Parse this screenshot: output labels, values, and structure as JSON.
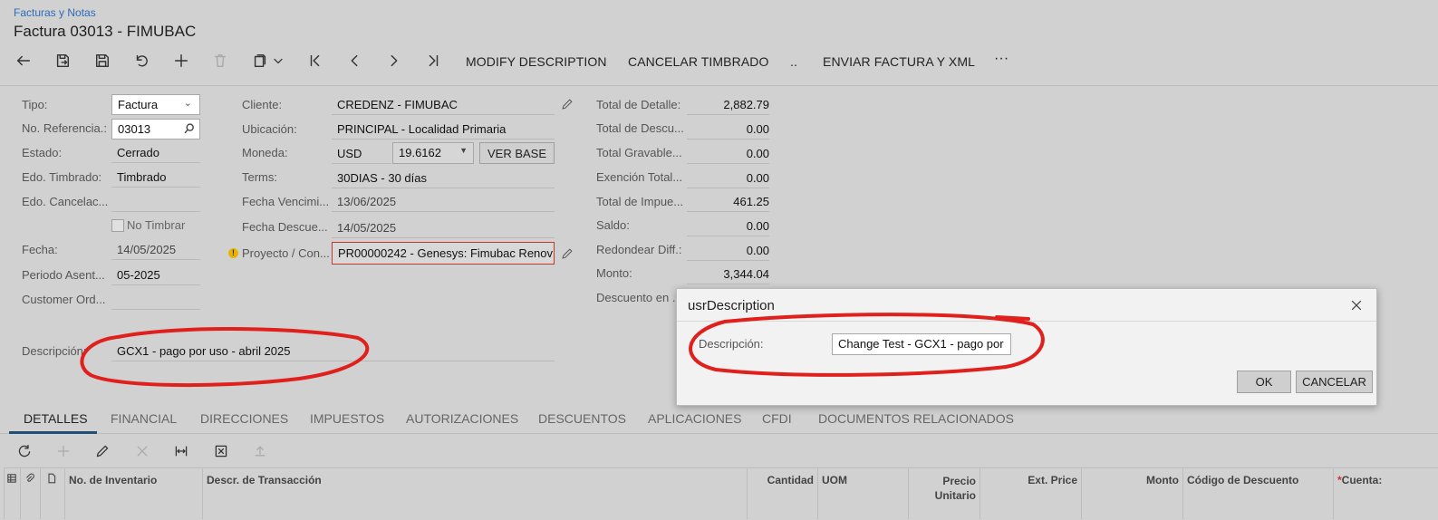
{
  "header": {
    "breadcrumb": "Facturas y Notas",
    "title": "Factura 03013 - FIMUBAC"
  },
  "toolbar": {
    "actions": [
      "MODIFY DESCRIPTION",
      "CANCELAR TIMBRADO",
      "..",
      "ENVIAR FACTURA Y XML",
      "···"
    ]
  },
  "form": {
    "col1": {
      "tipo_label": "Tipo:",
      "tipo_value": "Factura",
      "referencia_label": "No. Referencia.:",
      "referencia_value": "03013",
      "estado_label": "Estado:",
      "estado_value": "Cerrado",
      "timbrado_label": "Edo. Timbrado:",
      "timbrado_value": "Timbrado",
      "cancelacion_label": "Edo. Cancelac...",
      "no_timbrar_label": "No Timbrar",
      "fecha_label": "Fecha:",
      "fecha_value": "14/05/2025",
      "periodo_label": "Periodo Asent...",
      "periodo_value": "05-2025",
      "customer_order_label": "Customer Ord...",
      "descripcion_label": "Descripción:",
      "descripcion_value": "GCX1 - pago por uso - abril 2025"
    },
    "col2": {
      "cliente_label": "Cliente:",
      "cliente_value": "CREDENZ - FIMUBAC",
      "ubicacion_label": "Ubicación:",
      "ubicacion_value": "PRINCIPAL - Localidad Primaria",
      "moneda_label": "Moneda:",
      "moneda_value": "USD",
      "tasa_value": "19.6162",
      "ver_base_label": "VER BASE",
      "terms_label": "Terms:",
      "terms_value": "30DIAS - 30 días",
      "vencimiento_label": "Fecha Vencimi...",
      "vencimiento_value": "13/06/2025",
      "descuento_label": "Fecha Descue...",
      "descuento_value": "14/05/2025",
      "proyecto_label": "Proyecto / Con...",
      "proyecto_value": "PR00000242 - Genesys: Fimubac Renov"
    },
    "totals": {
      "detalle_label": "Total de Detalle:",
      "detalle_value": "2,882.79",
      "descuento_label": "Total de Descu...",
      "descuento_value": "0.00",
      "gravable_label": "Total Gravable...",
      "gravable_value": "0.00",
      "exencion_label": "Exención Total...",
      "exencion_value": "0.00",
      "impuesto_label": "Total de Impue...",
      "impuesto_value": "461.25",
      "saldo_label": "Saldo:",
      "saldo_value": "0.00",
      "redondear_label": "Redondear Diff.:",
      "redondear_value": "0.00",
      "monto_label": "Monto:",
      "monto_value": "3,344.04",
      "descuento_en_label": "Descuento en ..."
    }
  },
  "tabs": [
    "DETALLES",
    "FINANCIAL",
    "DIRECCIONES",
    "IMPUESTOS",
    "AUTORIZACIONES",
    "DESCUENTOS",
    "APLICACIONES",
    "CFDI",
    "DOCUMENTOS RELACIONADOS"
  ],
  "grid": {
    "columns": [
      "No. de Inventario",
      "Descr. de Transacción",
      "Cantidad",
      "UOM",
      "Precio\nUnitario",
      "Ext. Price",
      "Monto",
      "Código de Descuento",
      "Cuenta:"
    ]
  },
  "dialog": {
    "title": "usrDescription",
    "required_mark": "*",
    "field_label": "Descripción:",
    "field_value": "Change Test - GCX1 - pago por",
    "ok_label": "OK",
    "cancel_label": "CANCELAR"
  },
  "colors": {
    "annotation_red": "#e0201c",
    "link_blue": "#2a6cb8",
    "tab_underline": "#1f4f78",
    "warning": "#e8b400"
  }
}
